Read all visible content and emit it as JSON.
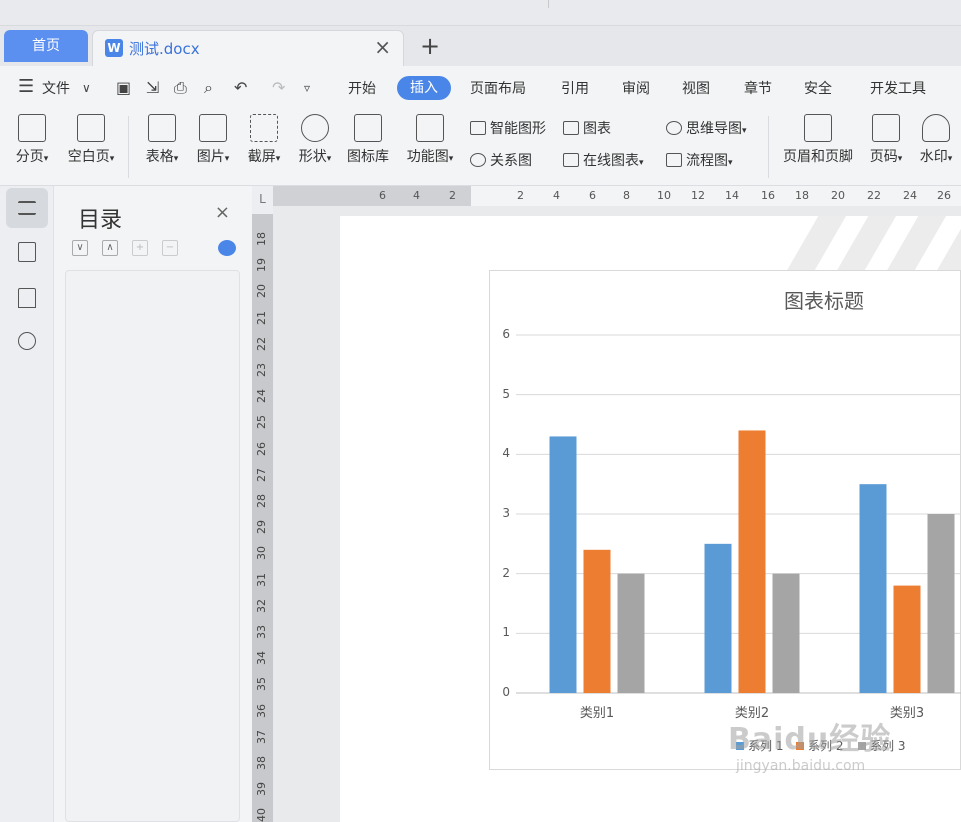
{
  "tabs": {
    "home": "首页",
    "doc_title": "测试.docx",
    "close": "×",
    "new": "+"
  },
  "menu": {
    "file": "文件",
    "items": [
      "开始",
      "插入",
      "页面布局",
      "引用",
      "审阅",
      "视图",
      "章节",
      "安全",
      "开发工具"
    ],
    "active": "插入"
  },
  "ribbon": {
    "big": [
      "分页",
      "空白页",
      "表格",
      "图片",
      "截屏",
      "形状",
      "图标库",
      "功能图"
    ],
    "small": [
      "智能图形",
      "图表",
      "关系图",
      "在线图表",
      "思维导图",
      "流程图"
    ],
    "big2": [
      "页眉和页脚",
      "页码",
      "水印"
    ]
  },
  "toc": {
    "title": "目录",
    "close": "×",
    "controls": [
      "∨",
      "∧",
      "+",
      "−"
    ]
  },
  "ruler": {
    "corner": "L",
    "h_ticks": [
      "6",
      "4",
      "2",
      "2",
      "4",
      "6",
      "8",
      "10",
      "12",
      "14",
      "16",
      "18",
      "20",
      "22",
      "24",
      "26"
    ],
    "v_ticks": [
      "18",
      "19",
      "20",
      "21",
      "22",
      "23",
      "24",
      "25",
      "26",
      "27",
      "28",
      "29",
      "30",
      "31",
      "32",
      "33",
      "34",
      "35",
      "36",
      "37",
      "38",
      "39",
      "40"
    ]
  },
  "chart_data": {
    "type": "bar",
    "title": "图表标题",
    "categories": [
      "类别1",
      "类别2",
      "类别3"
    ],
    "series": [
      {
        "name": "系列 1",
        "values": [
          4.3,
          2.5,
          3.5
        ],
        "color": "#5b9bd5"
      },
      {
        "name": "系列 2",
        "values": [
          2.4,
          4.4,
          1.8
        ],
        "color": "#ed7d31"
      },
      {
        "name": "系列 3",
        "values": [
          2,
          2,
          3
        ],
        "color": "#a5a5a5"
      }
    ],
    "y_ticks": [
      "0",
      "1",
      "2",
      "3",
      "4",
      "5",
      "6"
    ],
    "ylim": [
      0,
      6
    ],
    "grid": true,
    "legend": "bottom"
  },
  "watermark": {
    "main": "Baidu经验",
    "sub": "jingyan.baidu.com"
  }
}
